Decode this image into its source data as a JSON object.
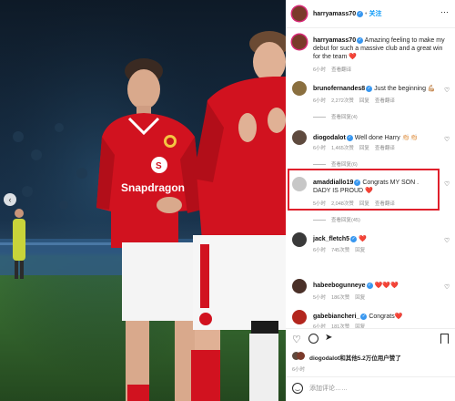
{
  "header": {
    "username": "harryamass70",
    "follow_label": "关注"
  },
  "caption": {
    "username": "harryamass70",
    "text": "Amazing feeling to make my debut for such a massive club and a great win for the team ❤️",
    "time": "6小时",
    "translate": "查看翻译"
  },
  "comments": [
    {
      "username": "brunofernandes8",
      "text": "Just the beginning 💪🏼",
      "time": "6小时",
      "likes": "2,272次赞",
      "reply": "回复",
      "translate": "查看翻译",
      "replies_link": "查看回复(4)"
    },
    {
      "username": "diogodalot",
      "text": "Well done Harry 👏🏻👏🏻",
      "time": "6小时",
      "likes": "1,465次赞",
      "reply": "回复",
      "translate": "查看翻译",
      "replies_link": "查看回复(6)"
    },
    {
      "username": "amaddiallo19",
      "text": "Congrats MY SON . DADY IS PROUD ❤️",
      "time": "5小时",
      "likes": "2,048次赞",
      "reply": "回复",
      "translate": "查看翻译",
      "replies_link": "查看回复(45)"
    },
    {
      "username": "jack_fletch5",
      "text": "❤️",
      "time": "6小时",
      "likes": "745次赞",
      "reply": "回复"
    },
    {
      "username": "habeebogunneye",
      "text": "❤️❤️❤️",
      "time": "5小时",
      "likes": "186次赞",
      "reply": "回复"
    },
    {
      "username": "gabebiancheri_",
      "text": "Congrats❤️",
      "time": "6小时",
      "likes": "181次赞",
      "reply": "回复"
    }
  ],
  "liked_by": "diogodalot和其他5.2万位用户赞了",
  "post_time": "6小时",
  "comment_placeholder": "添加评论……",
  "photo": {
    "sponsor": "Snapdragon"
  },
  "colors": {
    "kit_red": "#d1121f",
    "highlight": "#e0202c",
    "verified": "#3897f0",
    "story_ring": "#d62976"
  }
}
